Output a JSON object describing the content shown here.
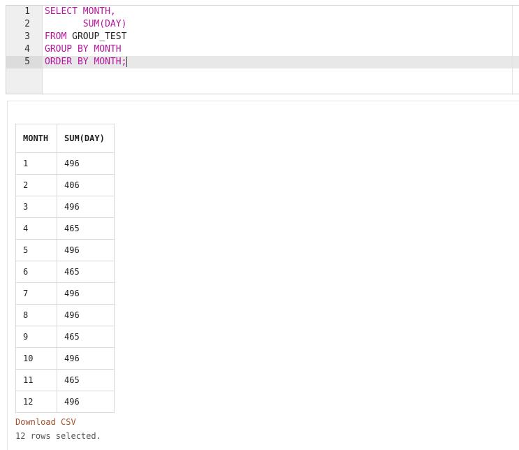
{
  "editor": {
    "line_numbers": [
      "1",
      "2",
      "3",
      "4",
      "5"
    ],
    "lines": [
      [
        {
          "t": "SELECT MONTH,",
          "k": true
        }
      ],
      [
        {
          "t": "       SUM(DAY)",
          "k": true
        }
      ],
      [
        {
          "t": "FROM",
          "k": true
        },
        {
          "t": " GROUP_TEST",
          "k": false
        }
      ],
      [
        {
          "t": "GROUP BY MONTH",
          "k": true
        }
      ],
      [
        {
          "t": "ORDER BY MONTH;",
          "k": true
        }
      ]
    ],
    "active_line": 5
  },
  "results": {
    "columns": [
      "MONTH",
      "SUM(DAY)"
    ],
    "rows": [
      [
        "1",
        "496"
      ],
      [
        "2",
        "406"
      ],
      [
        "3",
        "496"
      ],
      [
        "4",
        "465"
      ],
      [
        "5",
        "496"
      ],
      [
        "6",
        "465"
      ],
      [
        "7",
        "496"
      ],
      [
        "8",
        "496"
      ],
      [
        "9",
        "465"
      ],
      [
        "10",
        "496"
      ],
      [
        "11",
        "465"
      ],
      [
        "12",
        "496"
      ]
    ],
    "download_label": "Download CSV",
    "status": "12 rows selected."
  },
  "colors": {
    "keyword": "#b5179e",
    "link": "#a0522d"
  }
}
